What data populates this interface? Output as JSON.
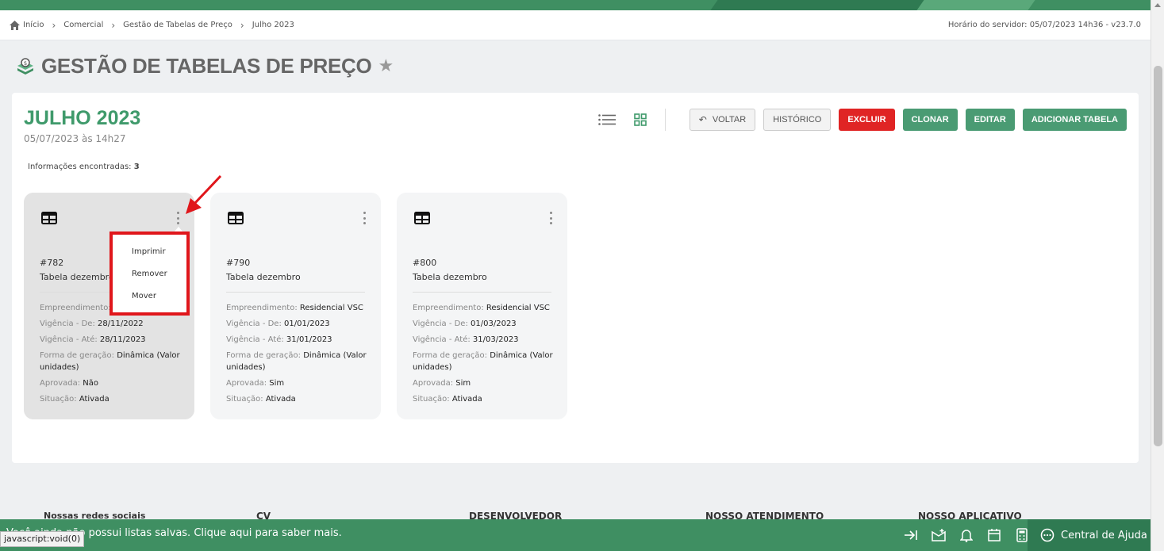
{
  "breadcrumb": {
    "items": [
      "Início",
      "Comercial",
      "Gestão de Tabelas de Preço",
      "Julho 2023"
    ],
    "server_time": "Horário do servidor: 05/07/2023 14h36 - v23.7.0"
  },
  "page": {
    "title": "GESTÃO DE TABELAS DE PREÇO"
  },
  "panel": {
    "title": "JULHO 2023",
    "subtitle": "05/07/2023 às 14h27",
    "info_label": "Informações encontradas:",
    "info_count": "3"
  },
  "toolbar": {
    "voltar": "VOLTAR",
    "historico": "HISTÓRICO",
    "excluir": "EXCLUIR",
    "clonar": "CLONAR",
    "editar": "EDITAR",
    "adicionar": "ADICIONAR TABELA"
  },
  "cards": [
    {
      "number": "#782",
      "name": "Tabela dezembro",
      "empreendimento_label": "Empreendimento:",
      "empreendimento": "",
      "vig_de_label": "Vigência - De:",
      "vig_de": "28/11/2022",
      "vig_ate_label": "Vigência - Até:",
      "vig_ate": "28/11/2023",
      "forma_label": "Forma de geração:",
      "forma": "Dinâmica (Valor unidades)",
      "aprovada_label": "Aprovada:",
      "aprovada": "Não",
      "situacao_label": "Situação:",
      "situacao": "Ativada"
    },
    {
      "number": "#790",
      "name": "Tabela dezembro",
      "empreendimento_label": "Empreendimento:",
      "empreendimento": "Residencial VSC",
      "vig_de_label": "Vigência - De:",
      "vig_de": "01/01/2023",
      "vig_ate_label": "Vigência - Até:",
      "vig_ate": "31/01/2023",
      "forma_label": "Forma de geração:",
      "forma": "Dinâmica (Valor unidades)",
      "aprovada_label": "Aprovada:",
      "aprovada": "Sim",
      "situacao_label": "Situação:",
      "situacao": "Ativada"
    },
    {
      "number": "#800",
      "name": "Tabela dezembro",
      "empreendimento_label": "Empreendimento:",
      "empreendimento": "Residencial VSC",
      "vig_de_label": "Vigência - De:",
      "vig_de": "01/03/2023",
      "vig_ate_label": "Vigência - Até:",
      "vig_ate": "31/03/2023",
      "forma_label": "Forma de geração:",
      "forma": "Dinâmica (Valor unidades)",
      "aprovada_label": "Aprovada:",
      "aprovada": "Sim",
      "situacao_label": "Situação:",
      "situacao": "Ativada"
    }
  ],
  "dropdown": {
    "items": [
      "Imprimir",
      "Remover",
      "Mover"
    ]
  },
  "footer": {
    "headings": [
      "Nossas redes sociais",
      "CV",
      "DESENVOLVEDOR",
      "NOSSO ATENDIMENTO",
      "NOSSO APLICATIVO"
    ],
    "message": "Você ainda não possui listas salvas. Clique aqui para saber mais.",
    "help": "Central de Ajuda",
    "status_url": "javascript:void(0)"
  },
  "colors": {
    "brand_green": "#3f8f62",
    "title_green": "#3f9a6b",
    "danger": "#e02424",
    "highlight": "#e0161b"
  },
  "icons": [
    "home-icon",
    "chevron-right-icon",
    "star-icon",
    "list-view-icon",
    "grid-view-icon",
    "undo-arrow-icon",
    "table-icon",
    "kebab-menu-icon",
    "collapse-icon",
    "inbox-icon",
    "bell-icon",
    "calendar-icon",
    "calculator-icon",
    "chat-icon"
  ]
}
